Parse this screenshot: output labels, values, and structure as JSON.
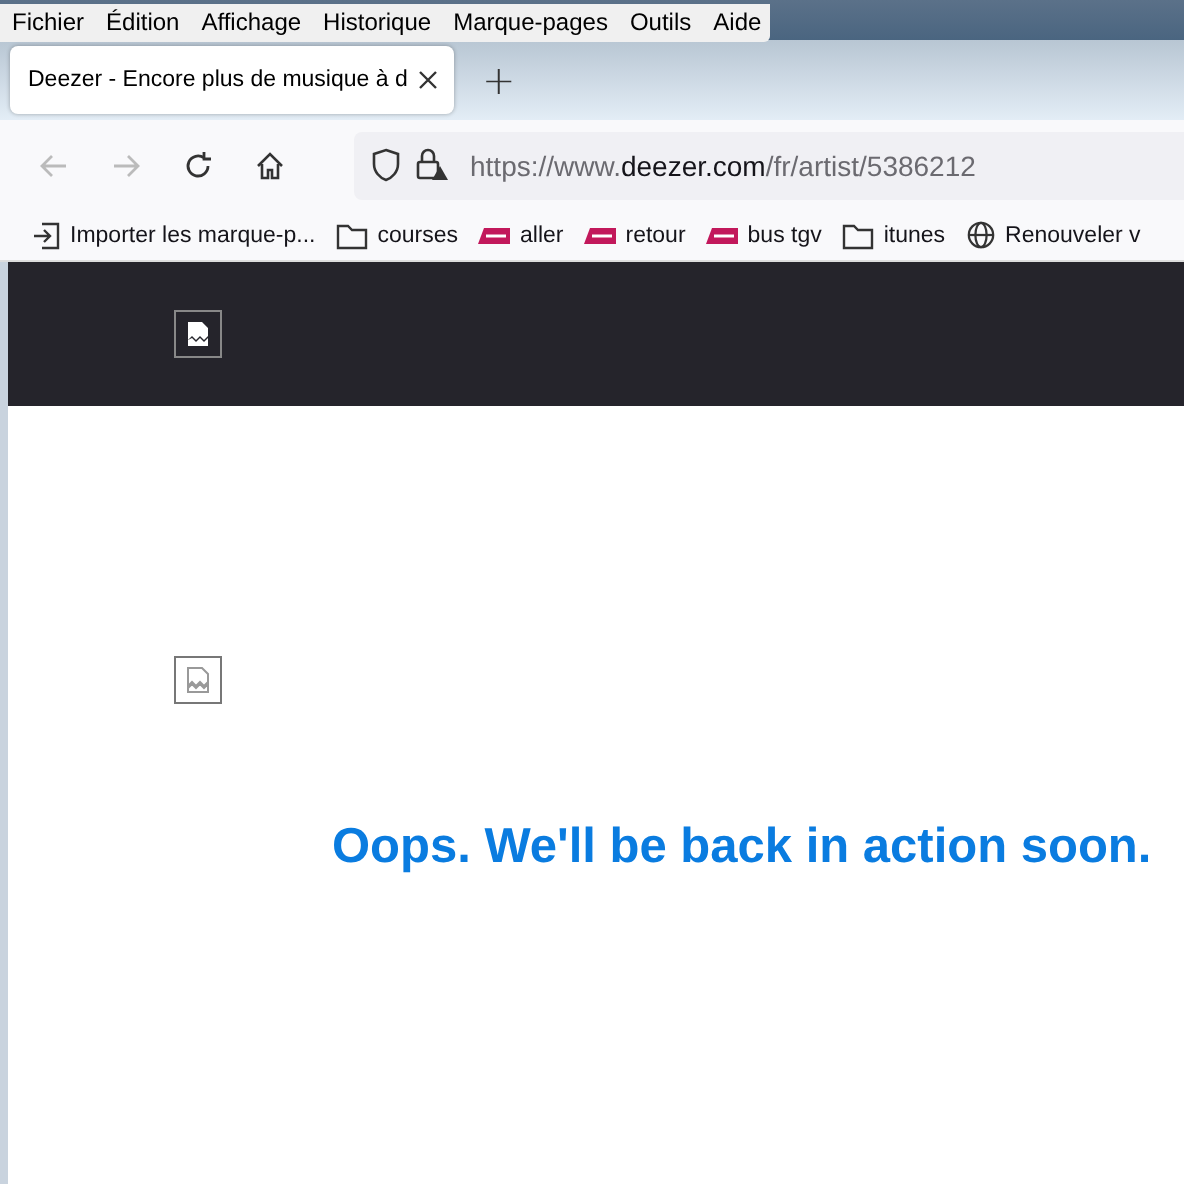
{
  "menu_bar": [
    "Fichier",
    "Édition",
    "Affichage",
    "Historique",
    "Marque-pages",
    "Outils",
    "Aide"
  ],
  "tabs": [
    {
      "title": "Deezer - Encore plus de musique à d",
      "selected": true
    }
  ],
  "new_tab": "+",
  "address_bar": {
    "prefix": "https://www.",
    "domain": "deezer.com",
    "path": "/fr/artist/5386212"
  },
  "bookmarks": [
    {
      "kind": "import",
      "label": "Importer les marque-p..."
    },
    {
      "kind": "folder",
      "label": "courses"
    },
    {
      "kind": "sncf",
      "label": "aller"
    },
    {
      "kind": "sncf",
      "label": "retour"
    },
    {
      "kind": "sncf",
      "label": "bus tgv"
    },
    {
      "kind": "folder",
      "label": "itunes"
    },
    {
      "kind": "globe",
      "label": "Renouveler v"
    }
  ],
  "page": {
    "message": "Oops. We'll be back in action soon."
  }
}
